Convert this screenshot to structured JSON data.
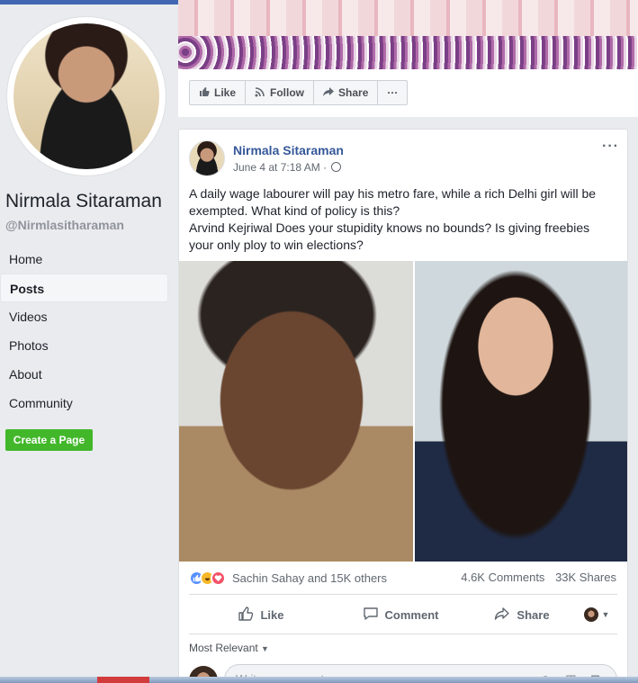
{
  "sidebar": {
    "page_name": "Nirmala Sitaraman",
    "page_handle": "@Nirmlasitharaman",
    "nav": [
      "Home",
      "Posts",
      "Videos",
      "Photos",
      "About",
      "Community"
    ],
    "active_nav": "Posts",
    "create_page_label": "Create a Page"
  },
  "page_actions": {
    "like": "Like",
    "follow": "Follow",
    "share": "Share",
    "more": "···"
  },
  "post": {
    "author": "Nirmala Sitaraman",
    "timestamp": "June 4 at 7:18 AM",
    "privacy_icon": "globe-icon",
    "menu": "···",
    "text_line1": "A daily wage labourer will pay his metro fare, while a rich Delhi girl will be exempted. What kind of policy is this?",
    "text_line2": "Arvind Kejriwal Does your stupidity knows no bounds? Is giving freebies your only ploy to win elections?",
    "reactions_text": "Sachin Sahay and 15K others",
    "comments_count": "4.6K Comments",
    "shares_count": "33K Shares",
    "actions": {
      "like": "Like",
      "comment": "Comment",
      "share": "Share"
    },
    "sort_label": "Most Relevant",
    "comment_placeholder": "Write a comment..."
  },
  "colors": {
    "fb_blue": "#4267b2",
    "link_blue": "#365899",
    "create_green": "#42b72a",
    "background": "#e9ebee"
  }
}
